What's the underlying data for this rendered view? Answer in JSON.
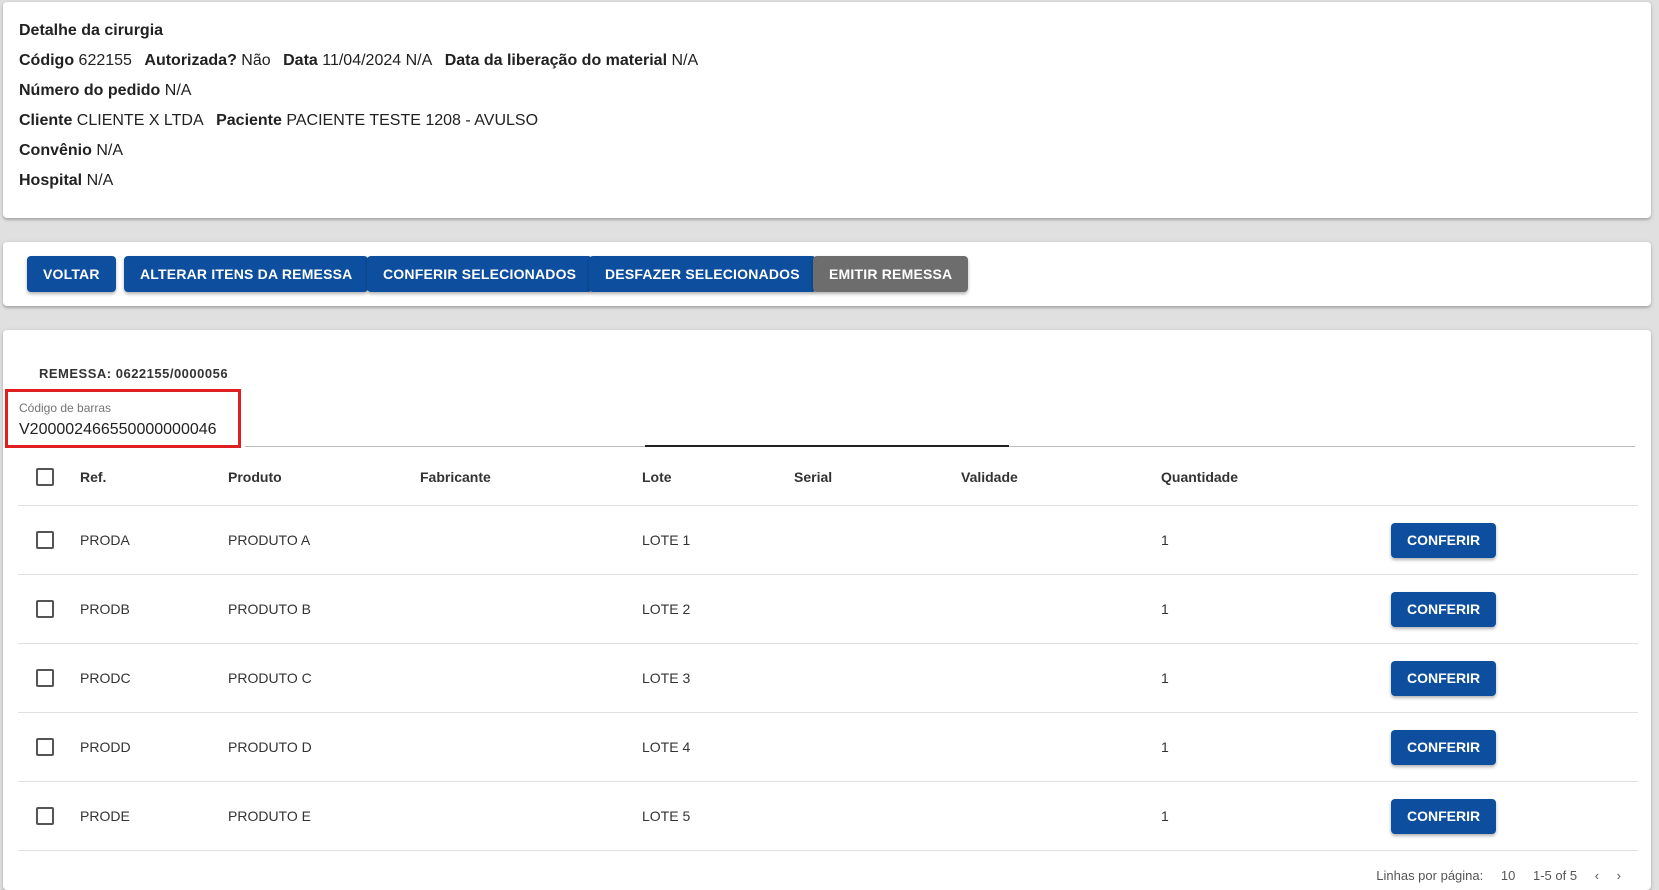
{
  "detail": {
    "title": "Detalhe da cirurgia",
    "codigo_label": "Código",
    "codigo_value": "622155",
    "autorizada_label": "Autorizada?",
    "autorizada_value": "Não",
    "data_label": "Data",
    "data_value": "11/04/2024 N/A",
    "liberacao_label": "Data da liberação do material",
    "liberacao_value": "N/A",
    "pedido_label": "Número do pedido",
    "pedido_value": "N/A",
    "cliente_label": "Cliente",
    "cliente_value": "CLIENTE X LTDA",
    "paciente_label": "Paciente",
    "paciente_value": "PACIENTE TESTE 1208 - AVULSO",
    "convenio_label": "Convênio",
    "convenio_value": "N/A",
    "hospital_label": "Hospital",
    "hospital_value": "N/A"
  },
  "actions": {
    "voltar": "VOLTAR",
    "alterar": "ALTERAR ITENS DA REMESSA",
    "conferir": "CONFERIR SELECIONADOS",
    "desfazer": "DESFAZER SELECIONADOS",
    "emitir": "EMITIR REMESSA"
  },
  "remessa": {
    "title": "REMESSA: 0622155/0000056",
    "barcode_label": "Código de barras",
    "barcode_value": "V200002466550000000046"
  },
  "table": {
    "headers": [
      "Ref.",
      "Produto",
      "Fabricante",
      "Lote",
      "Serial",
      "Validade",
      "Quantidade"
    ],
    "rows": [
      {
        "ref": "PRODA",
        "produto": "PRODUTO A",
        "fabricante": "",
        "lote": "LOTE 1",
        "serial": "",
        "validade": "",
        "quantidade": "1",
        "action": "CONFERIR"
      },
      {
        "ref": "PRODB",
        "produto": "PRODUTO B",
        "fabricante": "",
        "lote": "LOTE 2",
        "serial": "",
        "validade": "",
        "quantidade": "1",
        "action": "CONFERIR"
      },
      {
        "ref": "PRODC",
        "produto": "PRODUTO C",
        "fabricante": "",
        "lote": "LOTE 3",
        "serial": "",
        "validade": "",
        "quantidade": "1",
        "action": "CONFERIR"
      },
      {
        "ref": "PRODD",
        "produto": "PRODUTO D",
        "fabricante": "",
        "lote": "LOTE 4",
        "serial": "",
        "validade": "",
        "quantidade": "1",
        "action": "CONFERIR"
      },
      {
        "ref": "PRODE",
        "produto": "PRODUTO E",
        "fabricante": "",
        "lote": "LOTE 5",
        "serial": "",
        "validade": "",
        "quantidade": "1",
        "action": "CONFERIR"
      }
    ]
  },
  "pagination": {
    "rows_label": "Linhas por página:",
    "rows_value": "10",
    "range": "1-5 of 5",
    "prev_icon": "chevron-left-icon",
    "next_icon": "chevron-right-icon"
  }
}
